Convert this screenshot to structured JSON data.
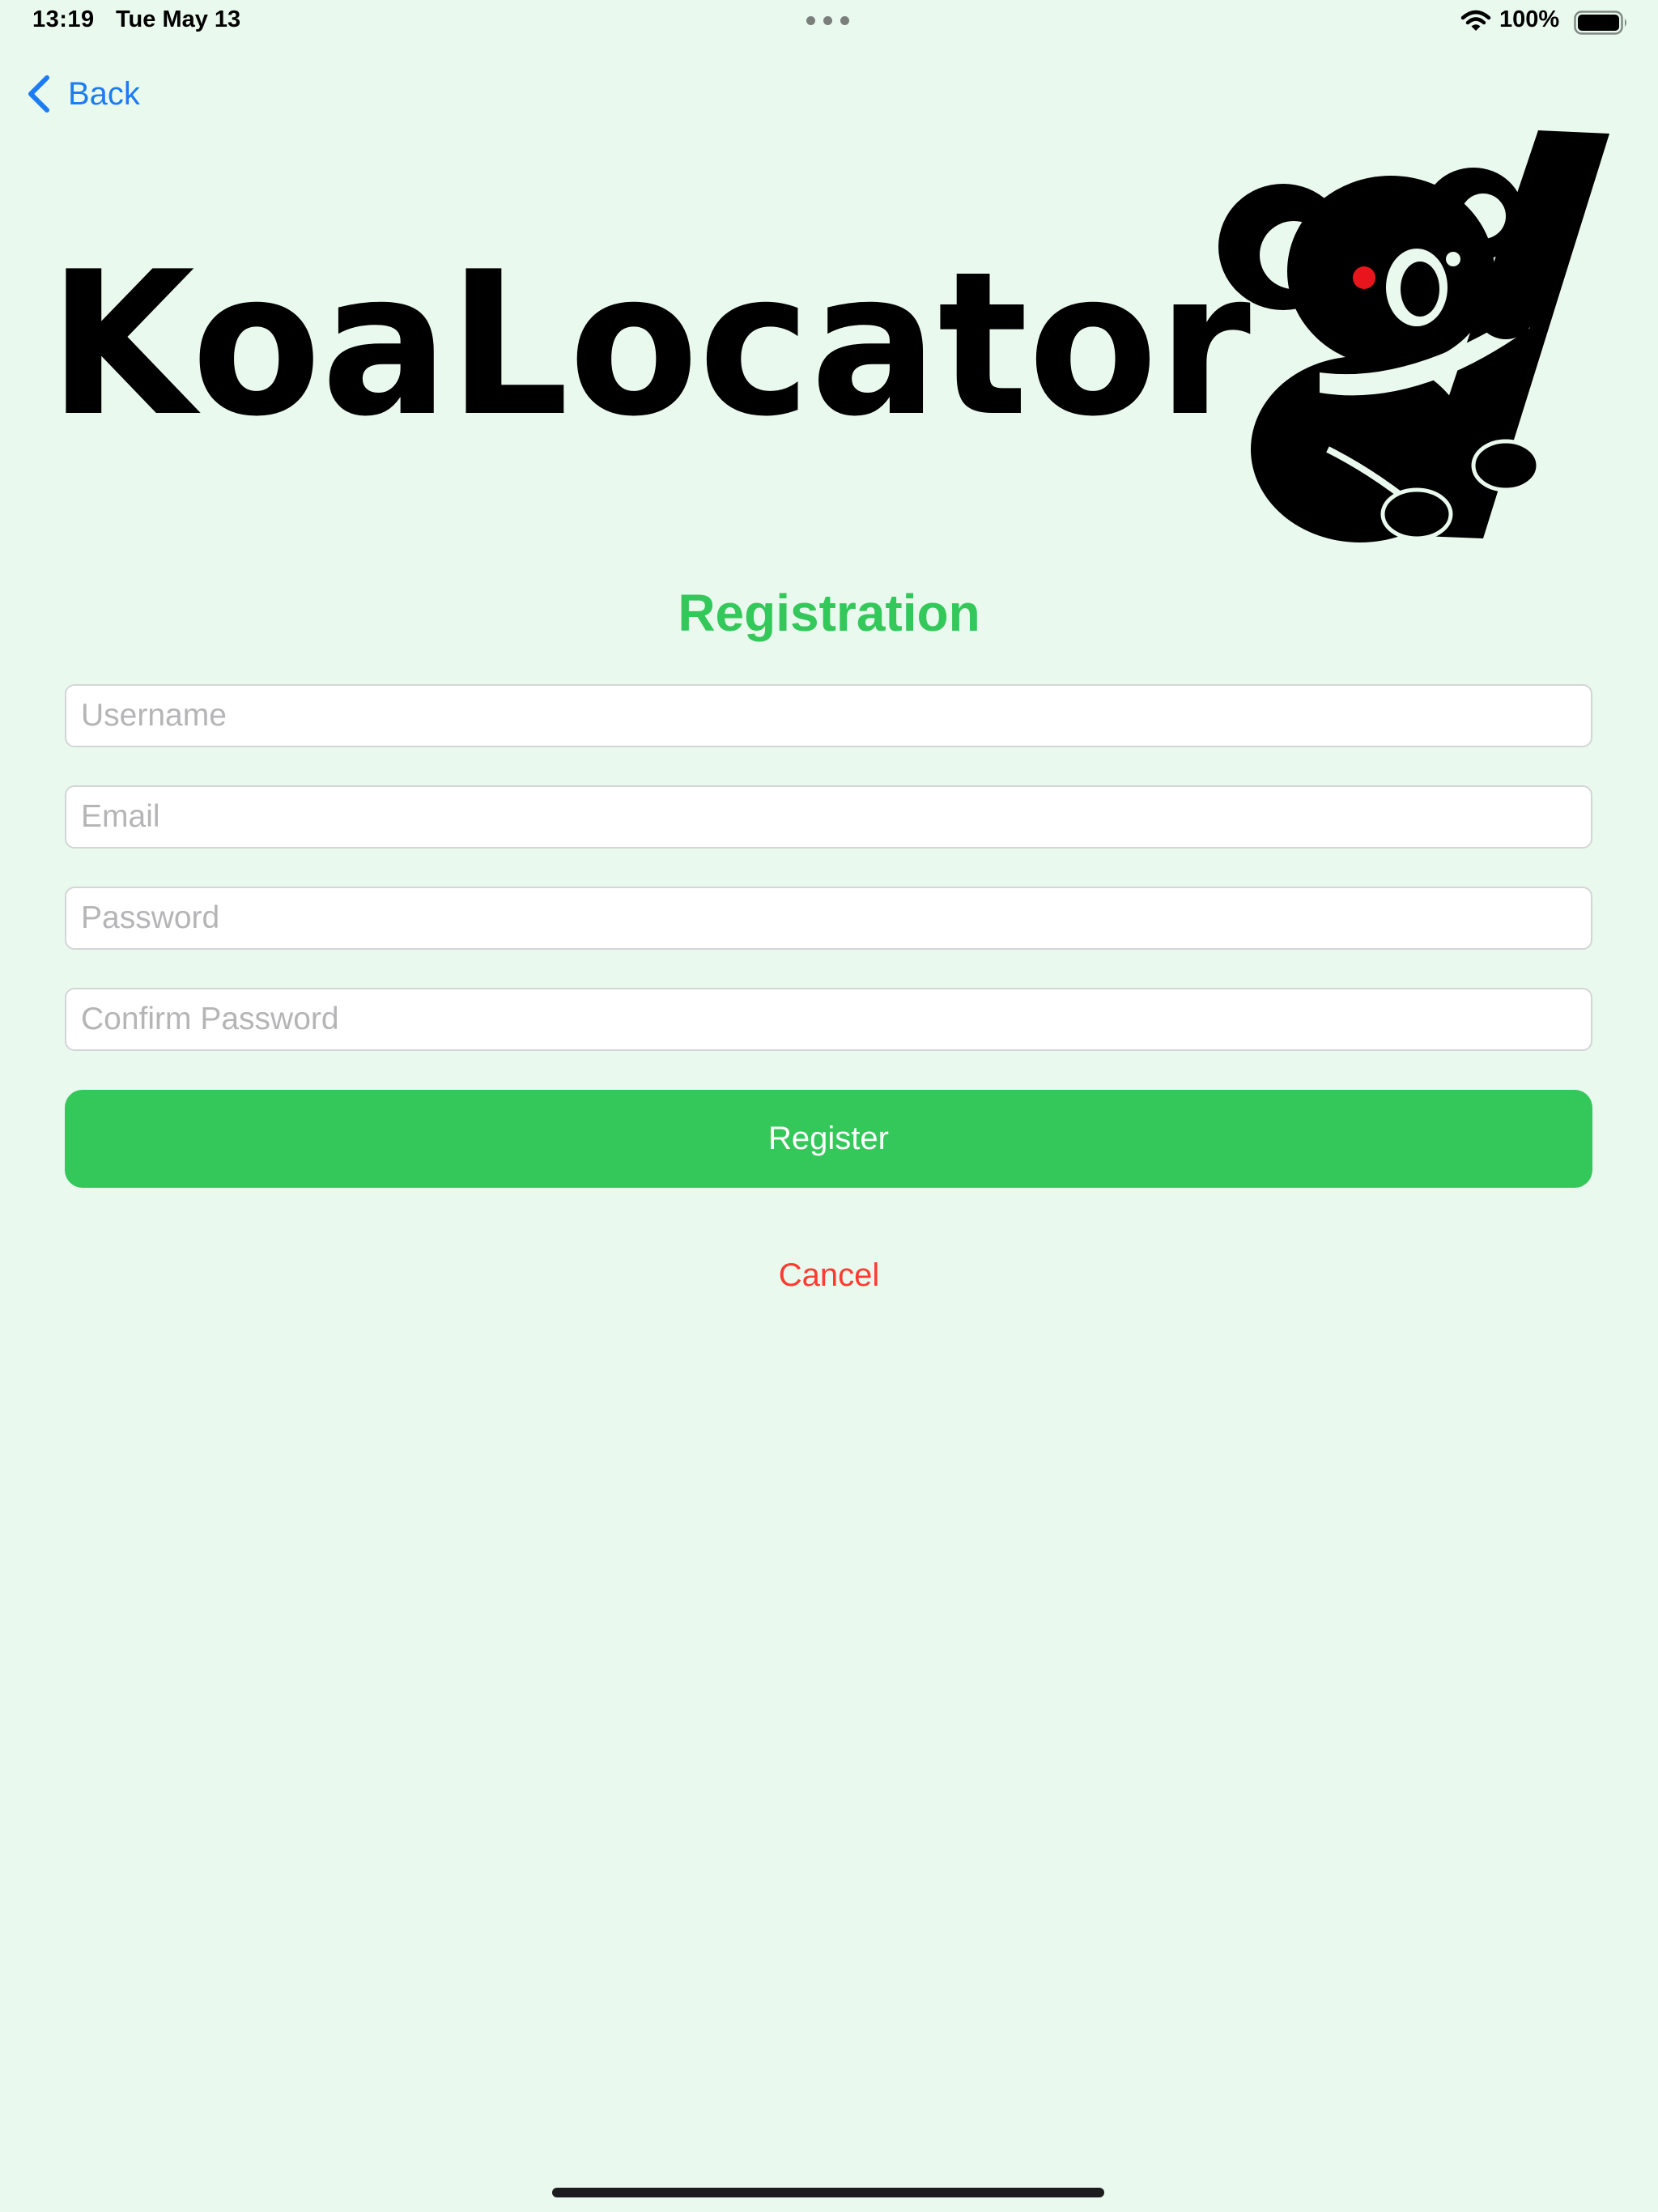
{
  "status_bar": {
    "time": "13:19",
    "date": "Tue May 13",
    "battery_percent": "100%",
    "icons": [
      "wifi-icon",
      "battery-icon",
      "multitasking-dots-icon"
    ]
  },
  "nav": {
    "back_label": "Back",
    "back_icon": "chevron-left-icon"
  },
  "logo": {
    "text": "KoaLocator",
    "mascot": "koala-icon"
  },
  "form": {
    "title": "Registration",
    "username": {
      "value": "",
      "placeholder": "Username"
    },
    "email": {
      "value": "",
      "placeholder": "Email"
    },
    "password": {
      "value": "",
      "placeholder": "Password"
    },
    "confirm_password": {
      "value": "",
      "placeholder": "Confirm Password"
    },
    "register_label": "Register",
    "cancel_label": "Cancel"
  },
  "colors": {
    "background": "#eaf9ee",
    "accent_green": "#34c759",
    "link_blue": "#1b7cf5",
    "destructive_red": "#ff3b30",
    "logo_black": "#000000",
    "koala_eye_red": "#e8161c"
  }
}
